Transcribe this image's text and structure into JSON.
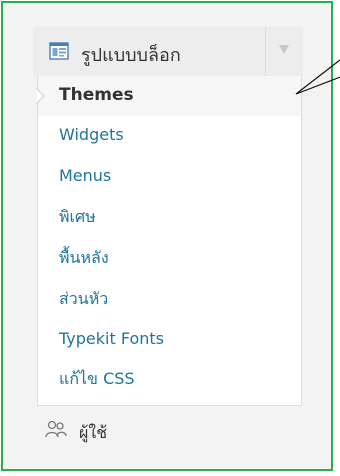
{
  "menu": {
    "header_label": "รูปแบบบล็อก",
    "header_icon": "appearance-icon",
    "toggle_icon": "triangle-down-icon",
    "items": [
      {
        "label": "Themes",
        "current": true
      },
      {
        "label": "Widgets",
        "current": false
      },
      {
        "label": "Menus",
        "current": false
      },
      {
        "label": "พิเศษ",
        "current": false
      },
      {
        "label": "พื้นหลัง",
        "current": false
      },
      {
        "label": "ส่วนหัว",
        "current": false
      },
      {
        "label": "Typekit Fonts",
        "current": false
      },
      {
        "label": "แก้ไข CSS",
        "current": false
      }
    ]
  },
  "users": {
    "label": "ผู้ใช้",
    "icon": "users-icon"
  },
  "colors": {
    "frame_border": "#22b14c",
    "link": "#21759b",
    "current_text": "#333333"
  }
}
